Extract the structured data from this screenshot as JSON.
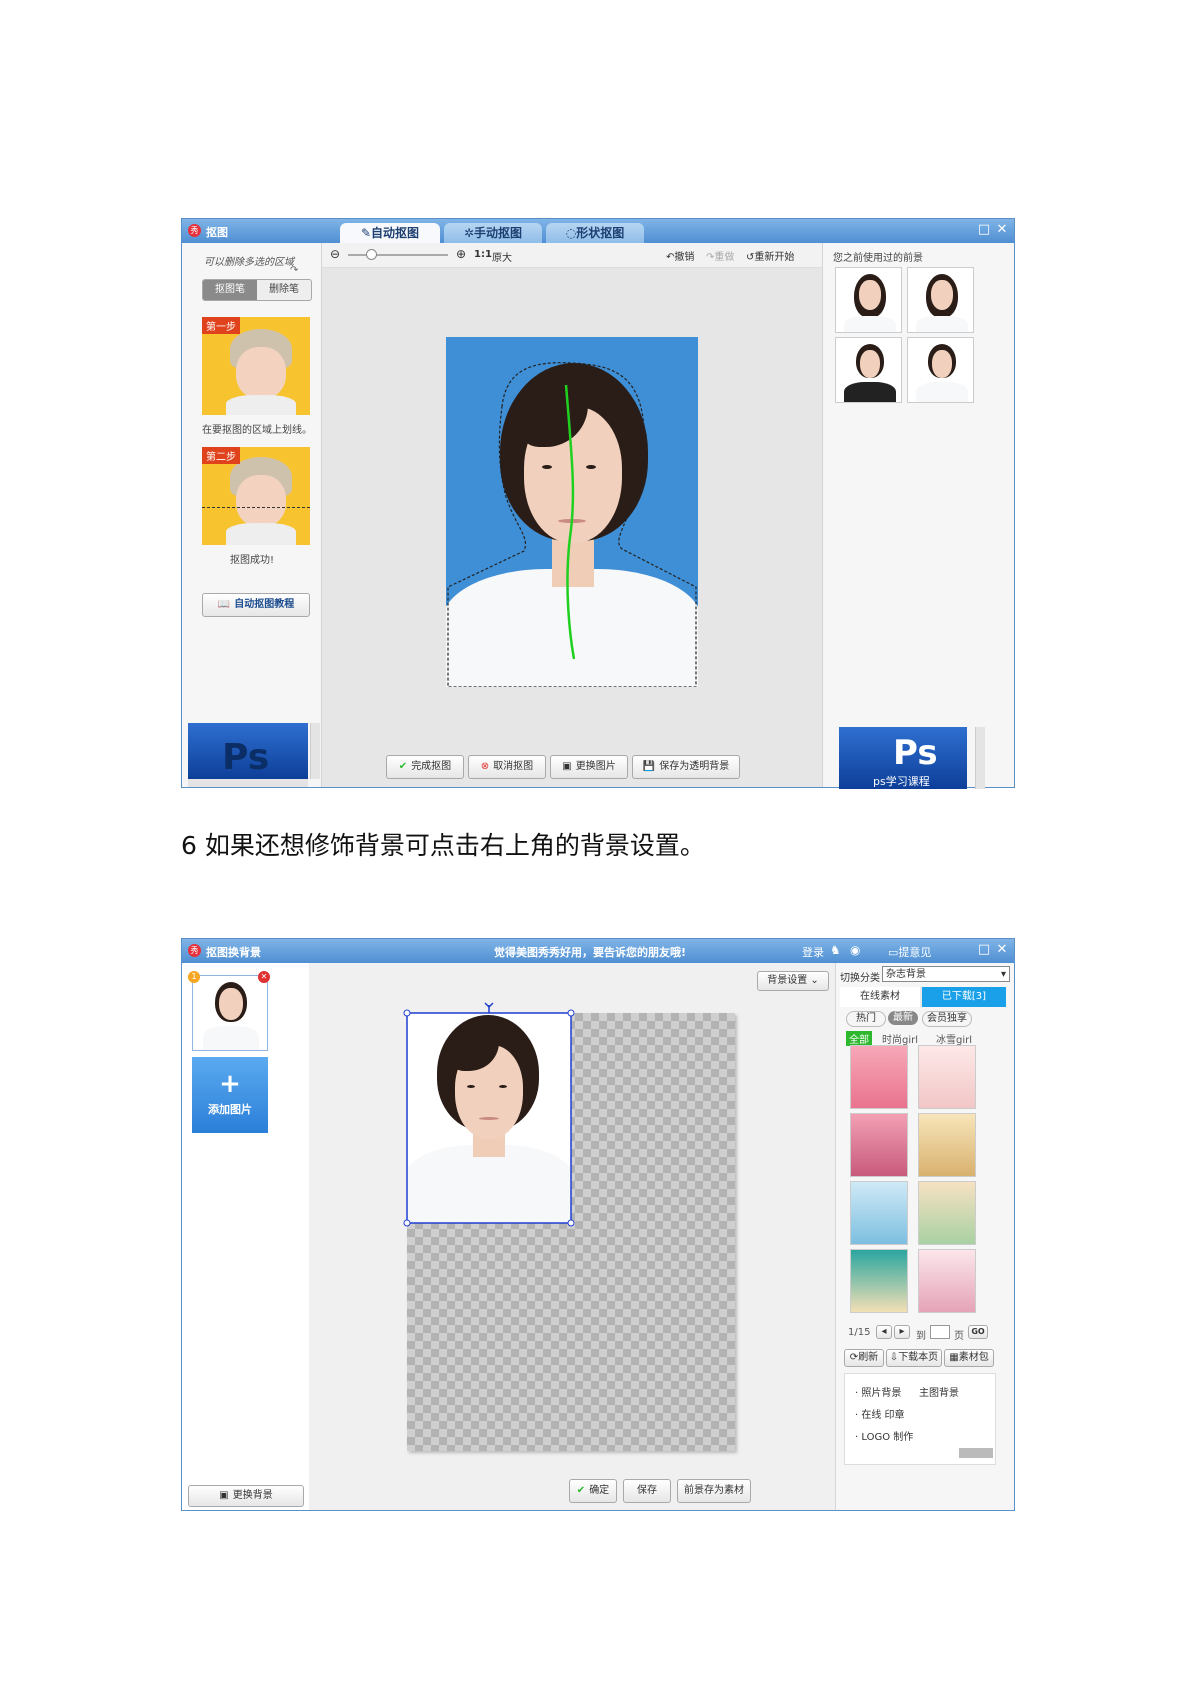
{
  "window1": {
    "title": "抠图",
    "tabs": [
      "自动抠图",
      "手动抠图",
      "形状抠图"
    ],
    "left": {
      "hint": "可以删除多选的区域",
      "mode_buttons": [
        "抠图笔",
        "删除笔"
      ],
      "step1_badge": "第一步",
      "step1_caption": "在要抠图的区域上划线。",
      "step2_badge": "第二步",
      "step2_caption": "抠图成功!",
      "tutorial_button": "自动抠图教程",
      "ad_text": "Ps"
    },
    "toolbar": {
      "zoom_ratio": "1:1",
      "original_size": "原大",
      "undo": "撤销",
      "redo": "重做",
      "restart": "重新开始"
    },
    "bottom_buttons": [
      "完成抠图",
      "取消抠图",
      "更换图片",
      "保存为透明背景"
    ],
    "right": {
      "recent_label": "您之前使用过的前景",
      "ad_text": "Ps",
      "ad_subtext": "ps学习课程"
    }
  },
  "caption": "6 如果还想修饰背景可点击右上角的背景设置。",
  "window2": {
    "title": "抠图换背景",
    "banner": "觉得美图秀秀好用，要告诉您的朋友哦!",
    "login": "登录",
    "feedback": "提意见",
    "left": {
      "thumb_badge": "1",
      "add_label": "添加图片",
      "change_bg_button": "更换背景"
    },
    "bg_settings_button": "背景设置",
    "bottom_buttons": [
      "确定",
      "保存",
      "前景存为素材"
    ],
    "right": {
      "category_label": "切换分类",
      "category_value": "杂志背景",
      "tabs": [
        "在线素材",
        "已下载[3]"
      ],
      "filters": [
        "热门",
        "最新",
        "会员独享"
      ],
      "subfilters": [
        "全部",
        "时尚girl",
        "冰雪girl"
      ],
      "pagination": {
        "page": "1/15",
        "goto_label": "到",
        "page_unit": "页",
        "go": "GO"
      },
      "actions": [
        "刷新",
        "下载本页",
        "素材包"
      ],
      "links": [
        "照片背景",
        "主图背景",
        "在线 印章",
        "LOGO 制作"
      ]
    },
    "colors": {
      "accent": "#3a8ee6",
      "green": "#2eb82e"
    }
  }
}
